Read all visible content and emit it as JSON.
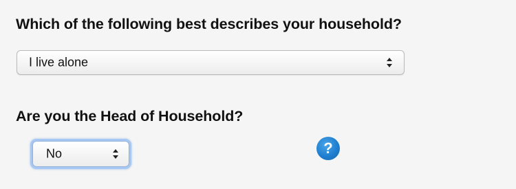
{
  "form": {
    "household_question": "Which of the following best describes your household?",
    "household_select": {
      "selected": "I live alone"
    },
    "head_question": "Are you the Head of Household?",
    "head_select": {
      "selected": "No"
    },
    "help_icon": {
      "glyph": "?",
      "icon": "help-icon",
      "color": "#1f7fd0"
    }
  },
  "colors": {
    "background": "#f5f5f5",
    "focus_ring": "#a8c8f2",
    "text": "#111111"
  }
}
